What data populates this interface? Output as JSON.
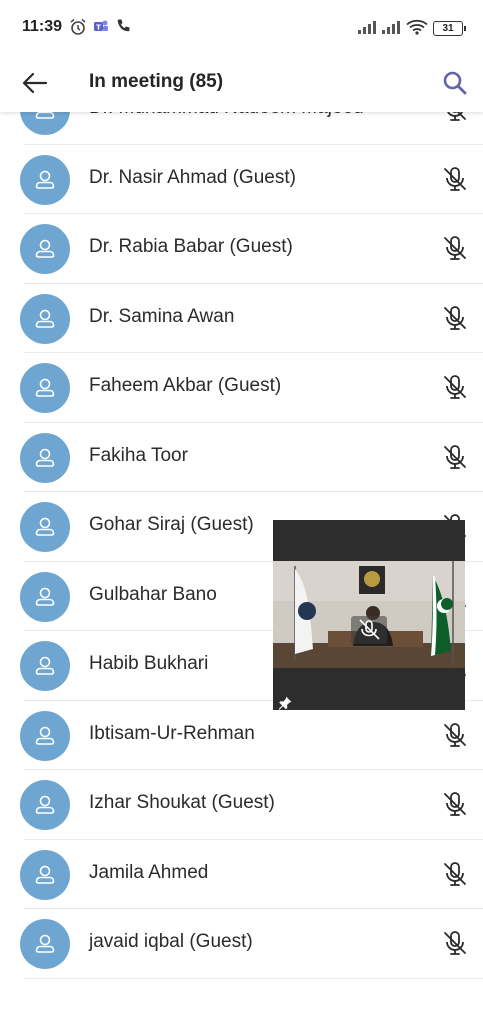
{
  "status_bar": {
    "time": "11:39",
    "battery": "31"
  },
  "header": {
    "title": "In meeting (85)",
    "back_icon": "arrow-left-icon",
    "search_icon": "search-icon"
  },
  "colors": {
    "avatar": "#6fa6d1",
    "accent": "#6264a7"
  },
  "participants": [
    {
      "name": "Dr. Muhammad Nadeem Majeed"
    },
    {
      "name": "Dr. Nasir Ahmad (Guest)"
    },
    {
      "name": "Dr. Rabia Babar (Guest)"
    },
    {
      "name": "Dr. Samina Awan"
    },
    {
      "name": "Faheem Akbar (Guest)"
    },
    {
      "name": "Fakiha Toor"
    },
    {
      "name": "Gohar Siraj (Guest)"
    },
    {
      "name": "Gulbahar Bano"
    },
    {
      "name": "Habib Bukhari"
    },
    {
      "name": "Ibtisam-Ur-Rehman"
    },
    {
      "name": "Izhar Shoukat (Guest)"
    },
    {
      "name": "Jamila Ahmed"
    },
    {
      "name": "javaid iqbal (Guest)"
    }
  ]
}
